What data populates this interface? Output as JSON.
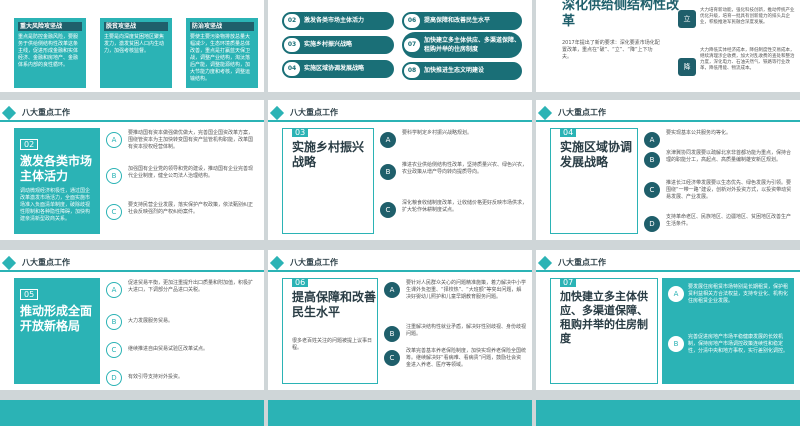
{
  "header": {
    "title": "八大重点工作"
  },
  "top": {
    "left_boxes": [
      {
        "title": "重大风险攻坚战",
        "text": "重点是防控金融风险，要服务于供给侧结构性改革这条主线，促进形成金融和实体经济、金融和房地产、金融体系内部的良性循环。"
      },
      {
        "title": "脱贫攻坚战",
        "text": "主要是向深度贫困地区聚焦发力，激发贫困人口内生动力，加强考核监督。"
      },
      {
        "title": "防治攻坚战",
        "text": "要使主要污染物排放总量大幅减少，生态环境质量总体改善，重点是打赢蓝天保卫战，调整产业结构，淘汰落后产能，调整能源结构，加大节能力度和考核，调整运输结构。"
      }
    ],
    "pills": [
      {
        "n": "02",
        "label": "激发各类市场主体活力"
      },
      {
        "n": "06",
        "label": "提高保障和改善民生水平"
      },
      {
        "n": "03",
        "label": "实施乡村振兴战略"
      },
      {
        "n": "07",
        "label": "加快建立多主体供应、多渠道保障、租购并举的住房制度"
      },
      {
        "n": "04",
        "label": "实施区域协调发展战略"
      },
      {
        "n": "08",
        "label": "加快推进生态文明建设"
      }
    ],
    "right": {
      "title": "深化供给侧结构性改革",
      "text": "2017年提出了新的要求：深化要素市场化配置改革，重点在“破”、“立”、“降”上下功夫。",
      "hex": [
        {
          "c": "立",
          "t": "大力培育新动能，强化科技创新，推动传统产业优化升级，培育一批具有创新能力的排头兵企业，积极推进军民融合深度发展。"
        },
        {
          "c": "降",
          "t": "大力降低实体经济成本，降低制度性交易成本，继续清理涉企收费，加大对乱收费的查处和整治力度，深化电力、石油天然气、铁路等行业改革，降低用能、物流成本。"
        }
      ]
    }
  },
  "cards": [
    {
      "num": "02",
      "title": "激发各类市场主体活力",
      "sub": "调动微观经济积极性，通过国企改革激发市场活力，全面实施市场准入负面清单制度，破除歧视性限制和各种隐性障碍，加快构建亲清新型政商关系。",
      "items": [
        {
          "k": "A",
          "t": "要推动国有资本做强做优做大，完善国企国资改革方案，围绕管资本为主加快转变国有资产监管机构职能，改革国有资本授权经营体制。"
        },
        {
          "k": "B",
          "t": "加强国有企业党的领导和党的建设，推动国有企业完善现代企业制度，健全公司法人治理结构。"
        },
        {
          "k": "C",
          "t": "要支持民营企业发展，落实保护产权政策，依法甄别纠正社会反映强烈的产权纠纷案件。"
        }
      ]
    },
    {
      "num": "03",
      "title": "实施乡村振兴战略",
      "sub": "",
      "items": [
        {
          "k": "A",
          "t": "要科学制定乡村振兴战略规划。"
        },
        {
          "k": "B",
          "t": "推进农业供给侧结构性改革，坚持质量兴农、绿色兴农，农业政策从增产导向转向提质导向。"
        },
        {
          "k": "C",
          "t": "深化粮食收储制度改革，让收储价格更好反映市场供求，扩大轮作休耕制度试点。"
        }
      ]
    },
    {
      "num": "04",
      "title": "实施区域协调发展战略",
      "sub": "",
      "items": [
        {
          "k": "A",
          "t": "要实现基本公共服务均等化。"
        },
        {
          "k": "B",
          "t": "京津冀协同发展要以疏解北京非首都功能为重点，保持合理的职能分工，高起点、高质量编制雄安新区规划。"
        },
        {
          "k": "C",
          "t": "推进长江经济带发展要以生态优先、绿色发展为引领。要围绕“一带一路”建设，创新对外投资方式，以投资带动贸易发展、产业发展。"
        },
        {
          "k": "D",
          "t": "支持革命老区、民族地区、边疆地区、贫困地区改善生产生活条件。"
        }
      ]
    },
    {
      "num": "05",
      "title": "推动形成全面开放新格局",
      "sub": "",
      "items": [
        {
          "k": "A",
          "t": "促进贸易平衡，更加注重提升出口质量和附加值，积极扩大进口，下调部分产品进口关税。"
        },
        {
          "k": "B",
          "t": "大力发展服务贸易。"
        },
        {
          "k": "C",
          "t": "继续推进自由贸易试验区改革试点。"
        },
        {
          "k": "D",
          "t": "有效引导支持对外投资。"
        }
      ]
    },
    {
      "num": "06",
      "title": "提高保障和改善民生水平",
      "sub": "很多老百姓关注的问题被提上议事日程。",
      "items": [
        {
          "k": "A",
          "t": "要针对人民群众关心的问题精准施策，着力解决中小学生课外负担重、“择校热”、“大班额”等突出问题，解决好婴幼儿照护和儿童早期教育服务问题。"
        },
        {
          "k": "B",
          "t": "注重解决结构性就业矛盾，解决好性别歧视、身份歧视问题。"
        },
        {
          "k": "C",
          "t": "改革完善基本养老保险制度，加快实现养老保险全国统筹。继续解决好“看病难、看病贵”问题，鼓励社会资金进入养老、医疗等领域。"
        }
      ]
    },
    {
      "num": "07",
      "title": "加快建立多主体供应、多渠道保障、租购并举的住房制度",
      "sub": "",
      "items": [
        {
          "k": "A",
          "t": "要发展住房租赁市场特别是长期租赁，保护租赁利益相关方合法权益，支持专业化、机构化住房租赁企业发展。"
        },
        {
          "k": "B",
          "t": "完善促进房地产市场平稳健康发展的长效机制，保持房地产市场调控政策连续性和稳定性，分清中央和地方事权，实行差别化调控。"
        }
      ]
    }
  ]
}
